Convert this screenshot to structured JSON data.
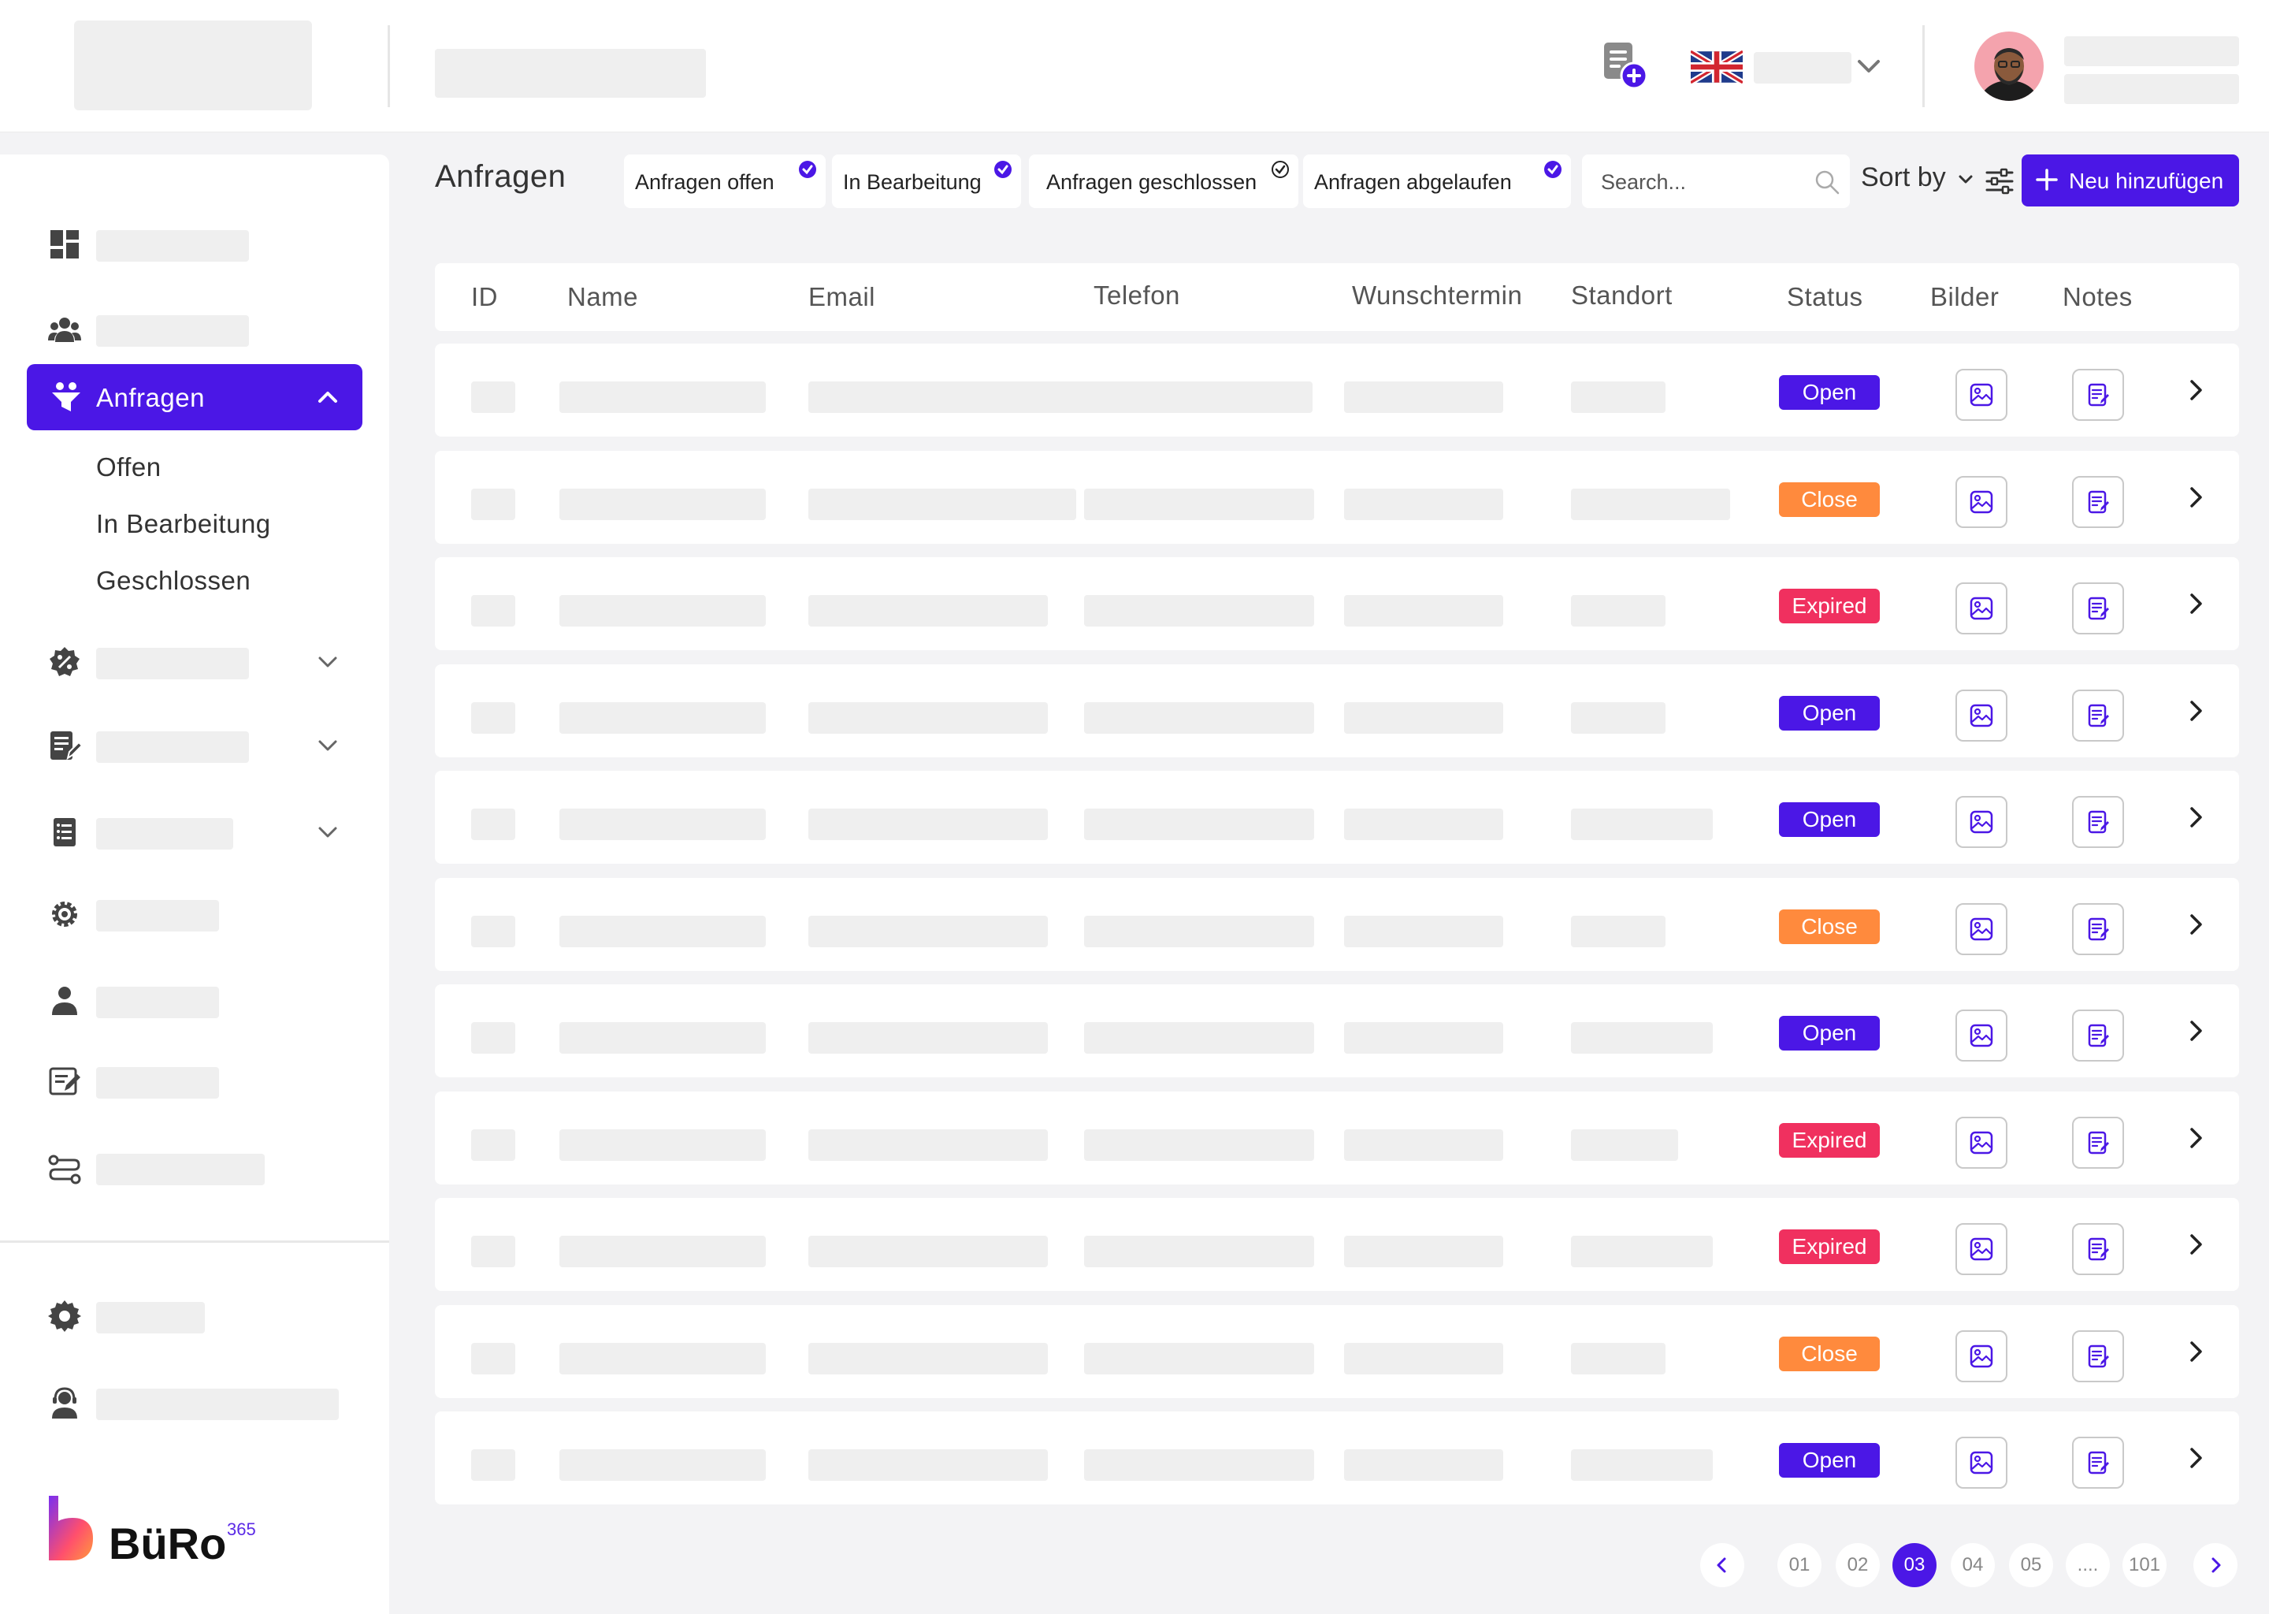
{
  "sidebar": {
    "active_item": {
      "label": "Anfragen",
      "icon": "funnel-users-icon"
    },
    "sub_items": [
      "Offen",
      "In Bearbeitung",
      "Geschlossen"
    ]
  },
  "main": {
    "title": "Anfragen",
    "filters": [
      {
        "label": "Anfragen offen"
      },
      {
        "label": "In Bearbeitung"
      },
      {
        "label": "Anfragen geschlossen"
      },
      {
        "label": "Anfragen abgelaufen"
      }
    ],
    "search_placeholder": "Search...",
    "sort_label": "Sort by",
    "add_button_label": "Neu hinzufügen",
    "columns": [
      "ID",
      "Name",
      "Email",
      "Telefon",
      "Wunschtermin",
      "Standort",
      "Status",
      "Bilder",
      "Notes"
    ],
    "rows": [
      {
        "status": "Open"
      },
      {
        "status": "Close"
      },
      {
        "status": "Expired"
      },
      {
        "status": "Open"
      },
      {
        "status": "Open"
      },
      {
        "status": "Close"
      },
      {
        "status": "Open"
      },
      {
        "status": "Expired"
      },
      {
        "status": "Expired"
      },
      {
        "status": "Close"
      },
      {
        "status": "Open"
      }
    ],
    "status_colors": {
      "Open": "#4b17e6",
      "Close": "#ff8a3d",
      "Expired": "#f0305f"
    }
  },
  "pagination": {
    "pages": [
      "01",
      "02",
      "03",
      "04",
      "05",
      "....",
      "101"
    ],
    "current": "03"
  },
  "brand": {
    "name": "BüRo",
    "superscript": "365"
  },
  "colors": {
    "accent": "#4b17e6"
  }
}
